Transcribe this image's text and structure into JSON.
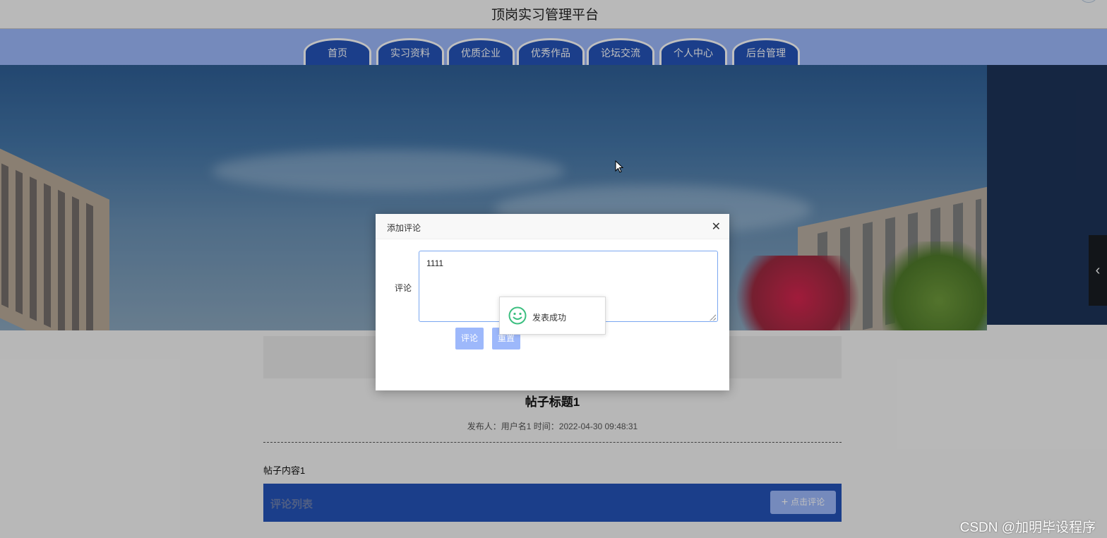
{
  "header": {
    "title": "顶岗实习管理平台"
  },
  "nav": {
    "items": [
      {
        "label": "首页"
      },
      {
        "label": "实习资料"
      },
      {
        "label": "优质企业"
      },
      {
        "label": "优秀作品"
      },
      {
        "label": "论坛交流"
      },
      {
        "label": "个人中心"
      },
      {
        "label": "后台管理"
      }
    ]
  },
  "banner": {
    "next_arrow": "‹"
  },
  "post": {
    "title": "帖子标题1",
    "meta": "发布人：用户名1 时间：2022-04-30 09:48:31",
    "content": "帖子内容1"
  },
  "comments": {
    "list_label": "评论列表",
    "add_button": "点击评论",
    "add_icon": "+"
  },
  "dialog": {
    "title": "添加评论",
    "close_icon": "✕",
    "field_label": "评论",
    "textarea_value": "1111",
    "submit_label": "评论",
    "reset_label": "重置"
  },
  "toast": {
    "message": "发表成功",
    "icon": "smile-icon"
  },
  "watermark": "CSDN @加明毕设程序",
  "colors": {
    "nav_bg": "#9db8fb",
    "tab_bg": "#2453b8",
    "primary_button": "#9db8fb",
    "success_icon": "#3cbf80"
  }
}
